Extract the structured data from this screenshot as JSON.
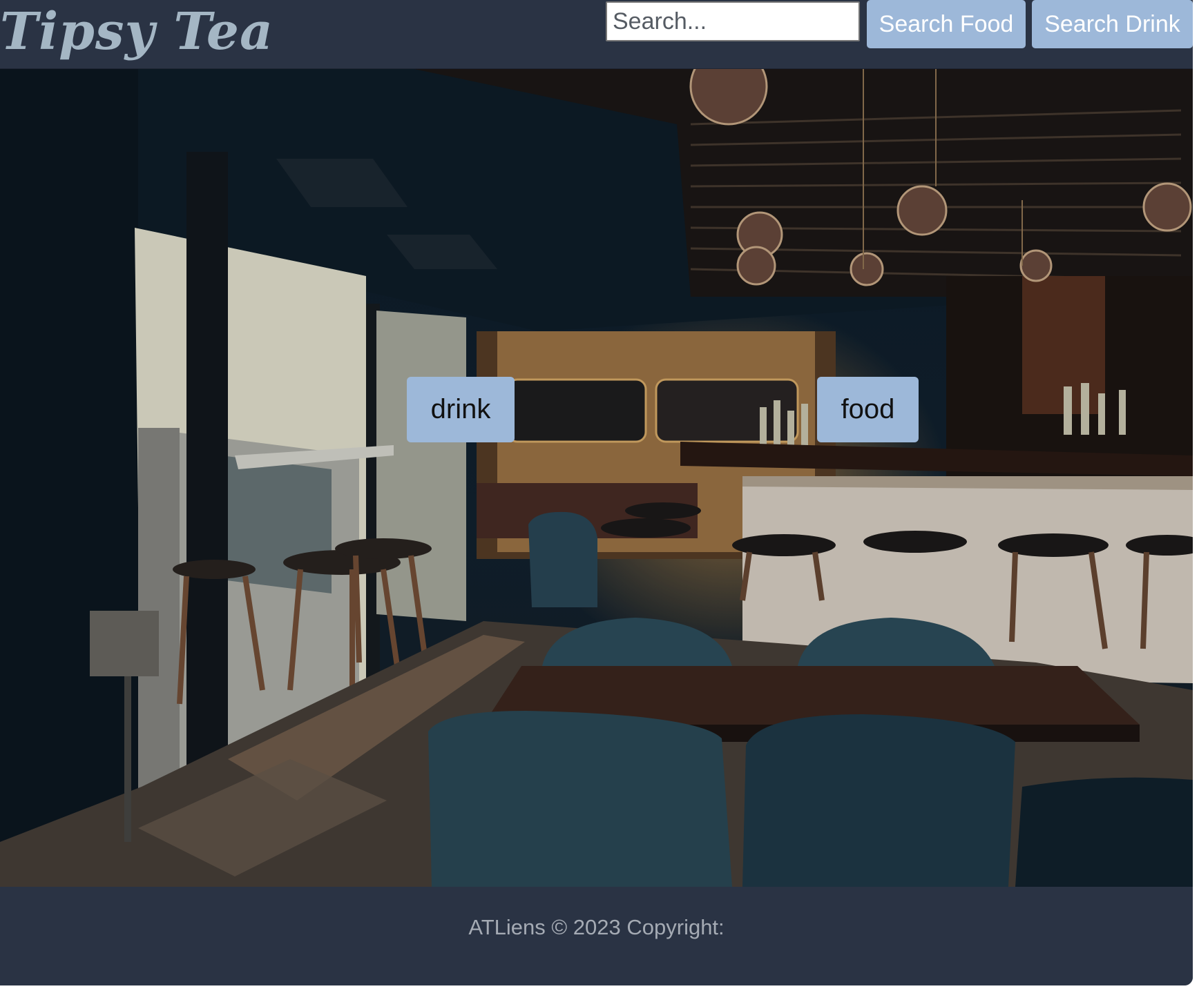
{
  "header": {
    "brand": "Tipsy Tea",
    "search": {
      "placeholder": "Search...",
      "value": ""
    },
    "search_food_label": "Search Food",
    "search_drink_label": "Search Drink"
  },
  "hero": {
    "photo": "bar-interior-photo",
    "categories": [
      {
        "label": "drink"
      },
      {
        "label": "food"
      }
    ]
  },
  "footer": {
    "copyright": "ATLiens © 2023 Copyright:"
  },
  "colors": {
    "nav_background": "#2a3344",
    "brand_text": "#a4b6c4",
    "button_background": "#9db8d9",
    "button_text": "#ffffff",
    "category_text": "#111111",
    "footer_text": "#a5abb4"
  }
}
